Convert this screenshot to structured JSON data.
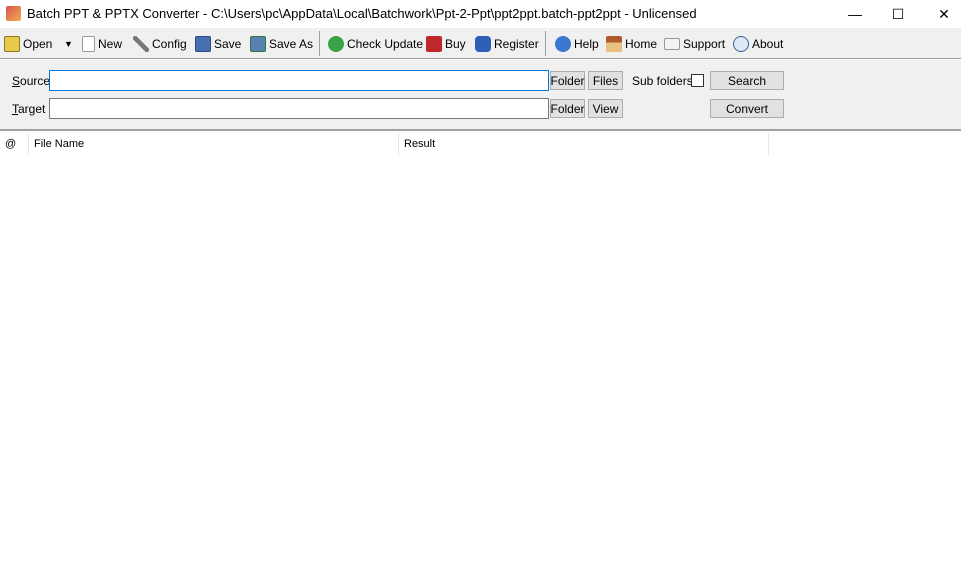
{
  "window": {
    "title": "Batch PPT & PPTX Converter - C:\\Users\\pc\\AppData\\Local\\Batchwork\\Ppt-2-Ppt\\ppt2ppt.batch-ppt2ppt - Unlicensed",
    "minimize": "—",
    "maximize": "☐",
    "close": "✕"
  },
  "toolbar": {
    "open": "Open",
    "dropdown": "▼",
    "new": "New",
    "config": "Config",
    "save": "Save",
    "save_as": "Save As",
    "check_update": "Check Update",
    "buy": "Buy",
    "register": "Register",
    "help": "Help",
    "home": "Home",
    "support": "Support",
    "about": "About"
  },
  "form": {
    "source_label_u": "S",
    "source_label_rest": "ource",
    "source_value": "",
    "target_label_u": "T",
    "target_label_rest": "arget",
    "target_value": "",
    "folder": "Folder",
    "files": "Files",
    "view": "View",
    "sub_folders": "Sub folders",
    "sub_folders_checked": false,
    "search": "Search",
    "convert": "Convert"
  },
  "table": {
    "columns": [
      "@",
      "File Name",
      "Result"
    ],
    "rows": []
  },
  "colors": {
    "accent": "#0078d7",
    "toolbar_bg": "#f0f0f0"
  }
}
